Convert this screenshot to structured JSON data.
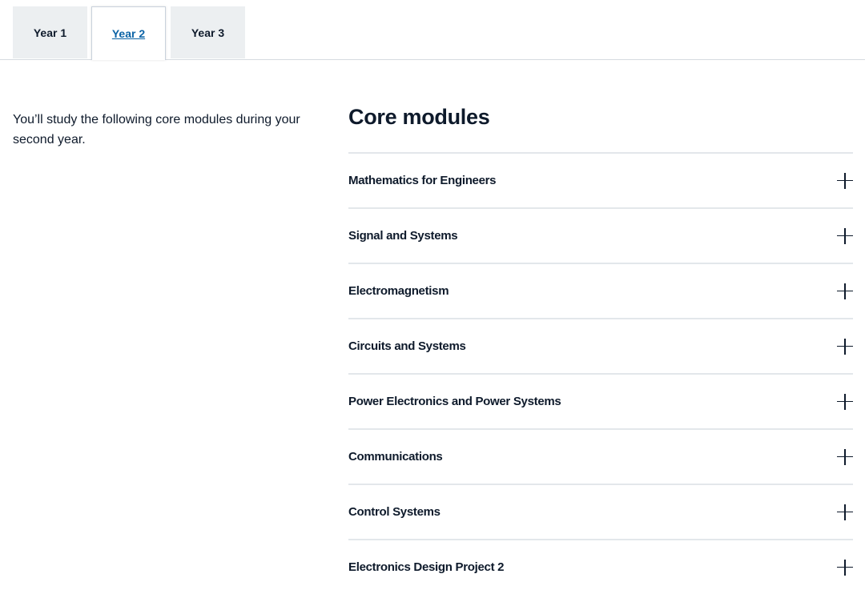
{
  "tabs": [
    {
      "label": "Year 1",
      "active": false
    },
    {
      "label": "Year 2",
      "active": true
    },
    {
      "label": "Year 3",
      "active": false
    }
  ],
  "intro": {
    "text": "You’ll study the following core modules during your second year."
  },
  "core": {
    "title": "Core modules",
    "modules": [
      {
        "label": "Mathematics for Engineers",
        "icon": "plus-icon"
      },
      {
        "label": "Signal and Systems",
        "icon": "plus-icon"
      },
      {
        "label": "Electromagnetism",
        "icon": "plus-icon"
      },
      {
        "label": "Circuits and Systems",
        "icon": "plus-icon"
      },
      {
        "label": "Power Electronics and Power Systems",
        "icon": "plus-icon"
      },
      {
        "label": "Communications",
        "icon": "plus-icon"
      },
      {
        "label": "Control Systems",
        "icon": "plus-icon"
      },
      {
        "label": "Electronics Design Project 2",
        "icon": "plus-icon"
      }
    ]
  },
  "colors": {
    "text": "#0e1a2b",
    "tab_bg": "#eceff1",
    "active_tab_text": "#0b63a6",
    "divider": "#e3e7eb"
  }
}
